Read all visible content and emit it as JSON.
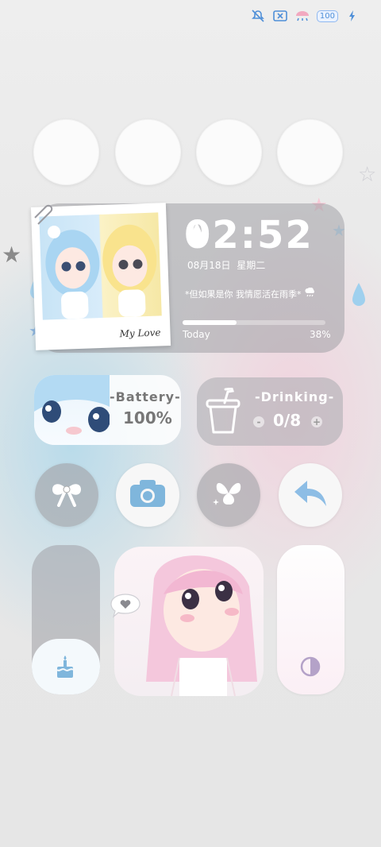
{
  "status_bar": {
    "icons": [
      "bell-muted-icon",
      "sim-x-icon",
      "wifi-umbrella-icon",
      "battery-badge-icon",
      "charging-bolt-icon"
    ],
    "battery_badge": "100"
  },
  "clock_widget": {
    "time": "02:52",
    "date": "08月18日",
    "weekday": "星期二",
    "quote": "*但如果是你 我情愿活在雨季*",
    "progress_label": "Today",
    "progress_percent": 38,
    "progress_text": "38%",
    "polaroid_caption": "My Love"
  },
  "battery_widget": {
    "label": "-Battery-",
    "value": "100%"
  },
  "drinking_widget": {
    "label": "-Drinking-",
    "value": "0/8",
    "minus": "-",
    "plus": "+"
  },
  "icon_row": [
    "bow-icon",
    "camera-icon",
    "butterfly-icon",
    "back-arrow-icon"
  ],
  "tall_widgets": {
    "left_icon": "cake-icon",
    "right_icon": "contrast-icon",
    "bubble_icon": "heart-bubble-icon"
  },
  "colors": {
    "accent_blue": "#4f8fd8",
    "card_gray": "#a0a0a5",
    "pink": "#f1d3de"
  }
}
